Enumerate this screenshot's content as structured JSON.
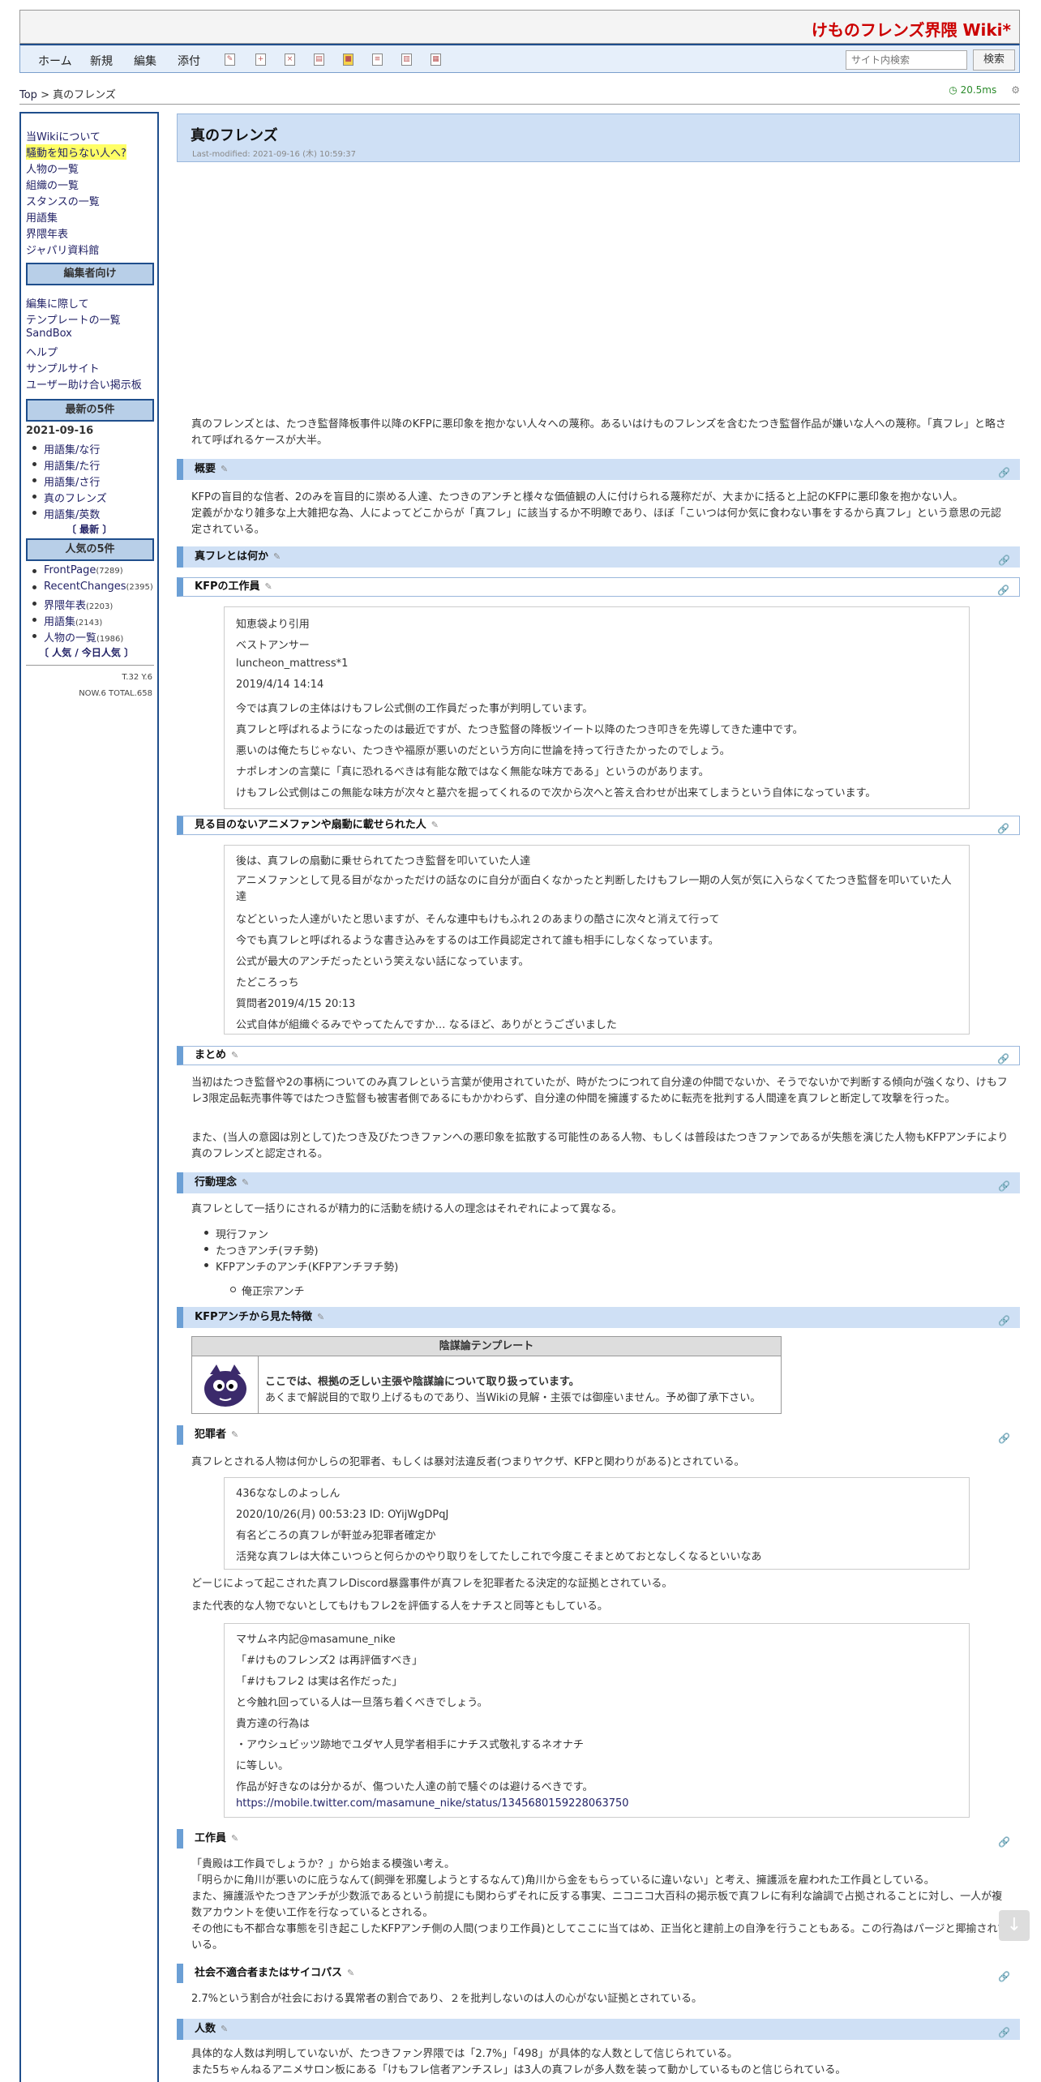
{
  "site_title": "けものフレンズ界隈 Wiki*",
  "nav": {
    "items": [
      "ホーム",
      "新規",
      "編集",
      "添付"
    ],
    "search_placeholder": "サイト内検索",
    "search_button": "検索"
  },
  "breadcrumb": {
    "top": "Top",
    "sep": " > ",
    "current": "真のフレンズ"
  },
  "perf": "20.5ms",
  "sidebar": {
    "links1": [
      "当Wikiについて",
      "騒動を知らない人へ?",
      "人物の一覧",
      "組織の一覧",
      "スタンスの一覧",
      "用語集",
      "界隈年表",
      "ジャパリ資料館"
    ],
    "editor_head": "編集者向け",
    "links2": [
      "編集に際して",
      "テンプレートの一覧",
      "SandBox",
      "ヘルプ",
      "サンプルサイト",
      "ユーザー助け合い掲示板"
    ],
    "latest_head": "最新の5件",
    "latest_date": "2021-09-16",
    "latest_items": [
      "用語集/な行",
      "用語集/た行",
      "用語集/さ行",
      "真のフレンズ",
      "用語集/英数"
    ],
    "latest_more": "〔 最新 〕",
    "pop_head": "人気の5件",
    "pop_items": [
      {
        "name": "FrontPage",
        "count": "(7289)"
      },
      {
        "name": "RecentChanges",
        "count": "(2395)"
      },
      {
        "name": "界隈年表",
        "count": "(2203)"
      },
      {
        "name": "用語集",
        "count": "(2143)"
      },
      {
        "name": "人物の一覧",
        "count": "(1986)"
      }
    ],
    "pop_more": "〔 人気 / 今日人気 〕",
    "counter1": "T.32 Y.6",
    "counter2": "NOW.6 TOTAL.658"
  },
  "page": {
    "title": "真のフレンズ",
    "last_modified": "Last-modified: 2021-09-16 (木) 10:59:37",
    "intro": "真のフレンズとは、たつき監督降板事件以降のKFPに悪印象を抱かない人々への蔑称。あるいはけものフレンズを含むたつき監督作品が嫌いな人への蔑称。「真フレ」と略されて呼ばれるケースが大半。",
    "s_overview": "概要",
    "overview1": "KFPの盲目的な信者、2のみを盲目的に崇める人達、たつきのアンチと様々な価値観の人に付けられる蔑称だが、大まかに括ると上記のKFPに悪印象を抱かない人。",
    "overview2": "定義がかなり雑多な上大雑把な為、人によってどこからが「真フレ」に該当するか不明瞭であり、ほぼ「こいつは何か気に食わない事をするから真フレ」という意思の元認定されている。",
    "s_what": "真フレとは何か",
    "s_kfp": "KFPの工作員",
    "q1": [
      "知恵袋より引用",
      "ベストアンサー",
      "luncheon_mattress*1",
      "2019/4/14 14:14",
      "今では真フレの主体はけもフレ公式側の工作員だった事が判明しています。",
      "真フレと呼ばれるようになったのは最近ですが、たつき監督の降板ツイート以降のたつき叩きを先導してきた連中です。",
      "悪いのは俺たちじゃない、たつきや福原が悪いのだという方向に世論を持って行きたかったのでしょう。",
      "ナポレオンの言葉に「真に恐れるべきは有能な敵ではなく無能な味方である」というのがあります。",
      "けもフレ公式側はこの無能な味方が次々と墓穴を掘ってくれるので次から次へと答え合わせが出来てしまうという自体になっています。"
    ],
    "s_blind": "見る目のないアニメファンや扇動に載せられた人",
    "q2": [
      "後は、真フレの扇動に乗せられてたつき監督を叩いていた人達",
      "アニメファンとして見る目がなかっただけの話なのに自分が面白くなかったと判断したけもフレ一期の人気が気に入らなくてたつき監督を叩いていた人達",
      "などといった人達がいたと思いますが、そんな連中もけもふれ２のあまりの酷さに次々と消えて行って",
      "今でも真フレと呼ばれるような書き込みをするのは工作員認定されて誰も相手にしなくなっています。",
      "公式が最大のアンチだったという笑えない話になっています。",
      "たどころっち",
      "質問者2019/4/15 20:13",
      "公式自体が組織ぐるみでやってたんですか… なるほど、ありがとうございました"
    ],
    "s_summary": "まとめ",
    "summary1": "当初はたつき監督や2の事柄についてのみ真フレという言葉が使用されていたが、時がたつにつれて自分達の仲間でないか、そうでないかで判断する傾向が強くなり、けもフレ3限定品転売事件等ではたつき監督も被害者側であるにもかかわらず、自分達の仲間を擁護するために転売を批判する人間達を真フレと断定して攻撃を行った。",
    "summary2": "また、(当人の意図は別として)たつき及びたつきファンへの悪印象を拡散する可能性のある人物、もしくは普段はたつきファンであるが失態を演じた人物もKFPアンチにより真のフレンズと認定される。",
    "s_action": "行動理念",
    "action1": "真フレとして一括りにされるが精力的に活動を続ける人の理念はそれぞれによって異なる。",
    "action_items": [
      "現行ファン",
      "たつきアンチ(ヲチ勢)",
      "KFPアンチのアンチ(KFPアンチヲチ勢)"
    ],
    "action_sub": [
      "俺正宗アンチ"
    ],
    "s_traits": "KFPアンチから見た特徴",
    "template_head": "陰謀論テンプレート",
    "template_a": "ここでは、根拠の乏しい主張や陰謀論について取り扱っています。",
    "template_b": "あくまで解説目的で取り上げるものであり、当Wikiの見解・主張では御座いません。予め御了承下さい。",
    "s_crime": "犯罪者",
    "crime1": "真フレとされる人物は何かしらの犯罪者、もしくは暴対法違反者(つまりヤクザ、KFPと関わりがある)とされている。",
    "q3": [
      "436ななしのよっしん",
      "2020/10/26(月) 00:53:23 ID: OYijWgDPqJ",
      "有名どころの真フレが軒並み犯罪者確定か",
      "活発な真フレは大体こいつらと何らかのやり取りをしてたしこれで今度こそまとめておとなしくなるといいなあ"
    ],
    "crime2": "どーじによって起こされた真フレDiscord暴露事件が真フレを犯罪者たる決定的な証拠とされている。",
    "crime3": "また代表的な人物でないとしてもけもフレ2を評価する人をナチスと同等ともしている。",
    "q4": [
      "マサムネ内記@masamune_nike",
      "「#けものフレンズ2 は再評価すべき」",
      "「#けもフレ2 は実は名作だった」",
      "と今触れ回っている人は一旦落ち着くべきでしょう。",
      "貴方達の行為は",
      "・アウシュビッツ跡地でユダヤ人見学者相手にナチス式敬礼するネオナチ",
      "に等しい。",
      "作品が好きなのは分かるが、傷ついた人達の前で騒ぐのは避けるべきです。",
      "https://mobile.twitter.com/masamune_nike/status/1345680159228063750"
    ],
    "s_agent": "工作員",
    "agent": [
      "「貴殿は工作員でしょうか？」から始まる模強い考え。",
      "「明らかに角川が悪いのに庇うなんて(飼弾を邪魔しようとするなんて)角川から金をもらっているに違いない」と考え、擁護派を雇われた工作員としている。",
      "また、擁護派やたつきアンチが少数派であるという前提にも関わらずそれに反する事実、ニコニコ大百科の掲示板で真フレに有利な論調で占拠されることに対し、一人が複数アカウントを使い工作を行なっているとされる。",
      "その他にも不都合な事態を引き起こしたKFPアンチ側の人間(つまり工作員)としてここに当てはめ、正当化と建前上の自浄を行うこともある。この行為はパージと揶揄されている。"
    ],
    "s_social": "社会不適合者またはサイコパス",
    "social": "2.7%という割合が社会における異常者の割合であり、２を批判しないのは人の心がない証拠とされている。",
    "s_count": "人数",
    "count": [
      "具体的な人数は判明していないが、たつきファン界隈では「2.7%」「498」が具体的な人数として信じられている。",
      "また5ちゃんねるアニメサロン板にある「けもフレ信者アンチスレ」は3人の真フレが多人数を装って動かしているものと信じられている。"
    ]
  }
}
